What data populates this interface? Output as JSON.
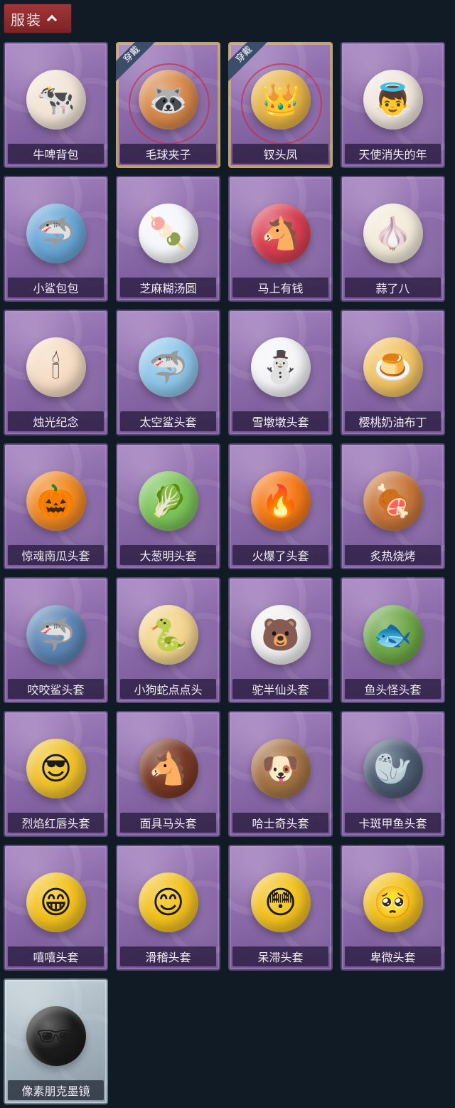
{
  "header": {
    "title": "服装",
    "chevron_icon": "chevron-up-icon"
  },
  "equipped_badge": "穿戴",
  "items": [
    {
      "name": "牛啤背包",
      "equipped": false,
      "rarity": "purple",
      "icon": "cow-beer-backpack",
      "color": "#f2e4d6",
      "glyph": "🐄"
    },
    {
      "name": "毛球夹子",
      "equipped": true,
      "rarity": "purple",
      "icon": "raccoon-drummer",
      "color": "#d98a4b",
      "glyph": "🦝"
    },
    {
      "name": "钗头凤",
      "equipped": true,
      "rarity": "purple",
      "icon": "phoenix-crown-doll",
      "color": "#e8b547",
      "glyph": "👑"
    },
    {
      "name": "天使消失的年",
      "equipped": false,
      "rarity": "purple",
      "icon": "angel-doll",
      "color": "#f0e6dc",
      "glyph": "👼"
    },
    {
      "name": "小鲨包包",
      "equipped": false,
      "rarity": "purple",
      "icon": "shark-bag",
      "color": "#6aa8d8",
      "glyph": "🦈"
    },
    {
      "name": "芝麻糊汤圆",
      "equipped": false,
      "rarity": "purple",
      "icon": "rice-ball",
      "color": "#f4f6fb",
      "glyph": "🍡"
    },
    {
      "name": "马上有钱",
      "equipped": false,
      "rarity": "purple",
      "icon": "red-horse",
      "color": "#d93f52",
      "glyph": "🐴"
    },
    {
      "name": "蒜了八",
      "equipped": false,
      "rarity": "purple",
      "icon": "garlic",
      "color": "#f3ead9",
      "glyph": "🧄"
    },
    {
      "name": "烛光纪念",
      "equipped": false,
      "rarity": "purple",
      "icon": "candle",
      "color": "#f6dcc4",
      "glyph": "🕯"
    },
    {
      "name": "太空鲨头套",
      "equipped": false,
      "rarity": "purple",
      "icon": "space-shark-head",
      "color": "#8ec6ea",
      "glyph": "🦈"
    },
    {
      "name": "雪墩墩头套",
      "equipped": false,
      "rarity": "purple",
      "icon": "snowman-head",
      "color": "#f5f5f8",
      "glyph": "⛄"
    },
    {
      "name": "樱桃奶油布丁",
      "equipped": false,
      "rarity": "purple",
      "icon": "pudding",
      "color": "#f2c464",
      "glyph": "🍮"
    },
    {
      "name": "惊魂南瓜头套",
      "equipped": false,
      "rarity": "purple",
      "icon": "pumpkin-head",
      "color": "#f08a24",
      "glyph": "🎃"
    },
    {
      "name": "大葱明头套",
      "equipped": false,
      "rarity": "purple",
      "icon": "scallion-head",
      "color": "#7cc45a",
      "glyph": "🥬"
    },
    {
      "name": "火爆了头套",
      "equipped": false,
      "rarity": "purple",
      "icon": "fire-head",
      "color": "#f57a18",
      "glyph": "🔥"
    },
    {
      "name": "炙热烧烤",
      "equipped": false,
      "rarity": "purple",
      "icon": "bbq-meat",
      "color": "#c9773b",
      "glyph": "🍖"
    },
    {
      "name": "咬咬鲨头套",
      "equipped": false,
      "rarity": "purple",
      "icon": "biting-shark",
      "color": "#5e87b6",
      "glyph": "🦈"
    },
    {
      "name": "小狗蛇点点头",
      "equipped": false,
      "rarity": "purple",
      "icon": "dog-snake",
      "color": "#f3d58e",
      "glyph": "🐍"
    },
    {
      "name": "驼半仙头套",
      "equipped": false,
      "rarity": "purple",
      "icon": "panda-bear-head",
      "color": "#f1f1f1",
      "glyph": "🐻"
    },
    {
      "name": "鱼头怪头套",
      "equipped": false,
      "rarity": "purple",
      "icon": "fish-head",
      "color": "#6fa84a",
      "glyph": "🐟"
    },
    {
      "name": "烈焰红唇头套",
      "equipped": false,
      "rarity": "purple",
      "icon": "yellow-mask",
      "color": "#f1c22b",
      "glyph": "😎"
    },
    {
      "name": "面具马头套",
      "equipped": false,
      "rarity": "purple",
      "icon": "horse-mask",
      "color": "#7a3a26",
      "glyph": "🐴"
    },
    {
      "name": "哈士奇头套",
      "equipped": false,
      "rarity": "purple",
      "icon": "husky-head",
      "color": "#a57446",
      "glyph": "🐶"
    },
    {
      "name": "卡斑甲鱼头套",
      "equipped": false,
      "rarity": "purple",
      "icon": "seal-head",
      "color": "#4d5d73",
      "glyph": "🦭"
    },
    {
      "name": "嘻嘻头套",
      "equipped": false,
      "rarity": "purple",
      "icon": "grin-emoji",
      "color": "#f3c21f",
      "glyph": "😁"
    },
    {
      "name": "滑稽头套",
      "equipped": false,
      "rarity": "purple",
      "icon": "funny-emoji",
      "color": "#f3c21f",
      "glyph": "😊"
    },
    {
      "name": "呆滞头套",
      "equipped": false,
      "rarity": "purple",
      "icon": "dazed-emoji",
      "color": "#f3c21f",
      "glyph": "😳"
    },
    {
      "name": "卑微头套",
      "equipped": false,
      "rarity": "purple",
      "icon": "humble-emoji",
      "color": "#f3c21f",
      "glyph": "🥺"
    },
    {
      "name": "像素朋克墨镜",
      "equipped": false,
      "rarity": "silver",
      "icon": "pixel-sunglasses",
      "color": "#1b1b1b",
      "glyph": "🕶"
    }
  ]
}
